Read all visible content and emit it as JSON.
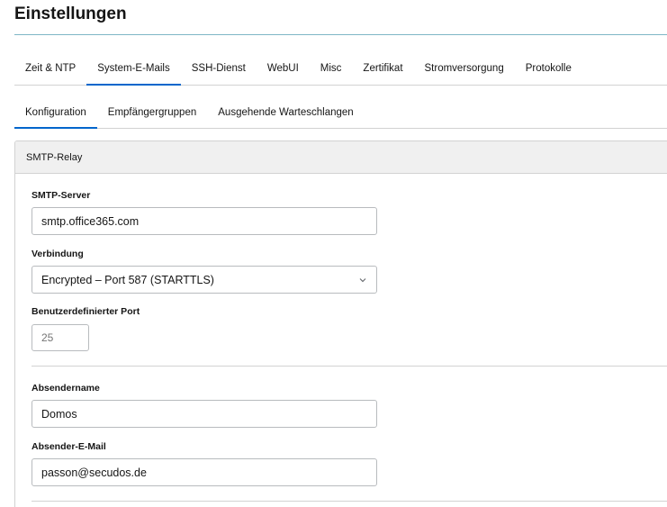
{
  "page": {
    "title": "Einstellungen"
  },
  "primary_tabs": [
    {
      "label": "Zeit & NTP",
      "active": false
    },
    {
      "label": "System-E-Mails",
      "active": true
    },
    {
      "label": "SSH-Dienst",
      "active": false
    },
    {
      "label": "WebUI",
      "active": false
    },
    {
      "label": "Misc",
      "active": false
    },
    {
      "label": "Zertifikat",
      "active": false
    },
    {
      "label": "Stromversorgung",
      "active": false
    },
    {
      "label": "Protokolle",
      "active": false
    }
  ],
  "secondary_tabs": [
    {
      "label": "Konfiguration",
      "active": true
    },
    {
      "label": "Empfängergruppen",
      "active": false
    },
    {
      "label": "Ausgehende Warteschlangen",
      "active": false
    }
  ],
  "card": {
    "title": "SMTP-Relay",
    "smtp_server": {
      "label": "SMTP-Server",
      "value": "smtp.office365.com"
    },
    "connection": {
      "label": "Verbindung",
      "value": "Encrypted – Port 587 (STARTTLS)"
    },
    "custom_port": {
      "label": "Benutzerdefinierter Port",
      "placeholder": "25"
    },
    "sender_name": {
      "label": "Absendername",
      "value": "Domos"
    },
    "sender_email": {
      "label": "Absender-E-Mail",
      "value": "passon@secudos.de"
    }
  },
  "icons": {
    "select_chevron": "chevron-down-icon"
  },
  "colors": {
    "active_tab": "#0066cc",
    "title_rule": "#7fb6c6",
    "card_header_bg": "#f0f0f0"
  }
}
